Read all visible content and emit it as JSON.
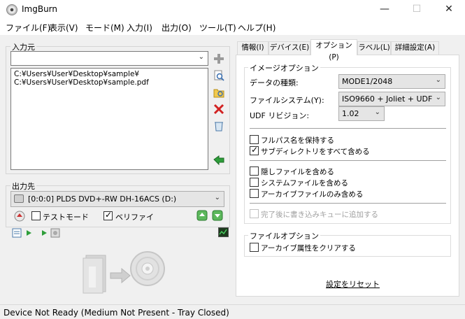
{
  "window": {
    "title": "ImgBurn",
    "minimize": "—",
    "maximize": "☐",
    "close": "✕"
  },
  "menu": [
    "ファイル(F)",
    "表示(V)",
    "モード(M)",
    "入力(I)",
    "出力(O)",
    "ツール(T)",
    "ヘルプ(H)"
  ],
  "source": {
    "title": "入力元",
    "combo_value": "",
    "files": [
      "C:¥Users¥User¥Desktop¥sample¥",
      "C:¥Users¥User¥Desktop¥sample.pdf"
    ]
  },
  "destination": {
    "title": "出力先",
    "drive": "[0:0:0] PLDS DVD+-RW DH-16ACS (D:)",
    "test_mode_label": "テストモード",
    "test_mode_checked": false,
    "verify_label": "ベリファイ",
    "verify_checked": true
  },
  "tabs": [
    "情報(I)",
    "デバイス(E)",
    "オプション(P)",
    "ラベル(L)",
    "詳細設定(A)"
  ],
  "active_tab": "オプション(P)",
  "image_options": {
    "title": "イメージオプション",
    "data_type_label": "データの種類:",
    "data_type_value": "MODE1/2048",
    "filesystem_label": "ファイルシステム(Y):",
    "filesystem_value": "ISO9660 + Joliet + UDF",
    "udf_label": "UDF リビジョン:",
    "udf_value": "1.02",
    "checks": [
      {
        "label": "フルパス名を保持する",
        "checked": false
      },
      {
        "label": "サブディレクトリをすべて含める",
        "checked": true
      },
      {
        "label": "隠しファイルを含める",
        "checked": false
      },
      {
        "label": "システムファイルを含める",
        "checked": false
      },
      {
        "label": "アーカイブファイルのみ含める",
        "checked": false
      }
    ],
    "add_to_queue_label": "完了後に書き込みキューに追加する"
  },
  "file_options": {
    "title": "ファイルオプション",
    "clear_archive_label": "アーカイブ属性をクリアする"
  },
  "reset_label": "設定をリセット",
  "status": "Device Not Ready (Medium Not Present - Tray Closed)",
  "colors": {
    "accent_green": "#2e9e3a",
    "delete_red": "#d22222",
    "disabled_text": "#a0a0a0"
  }
}
